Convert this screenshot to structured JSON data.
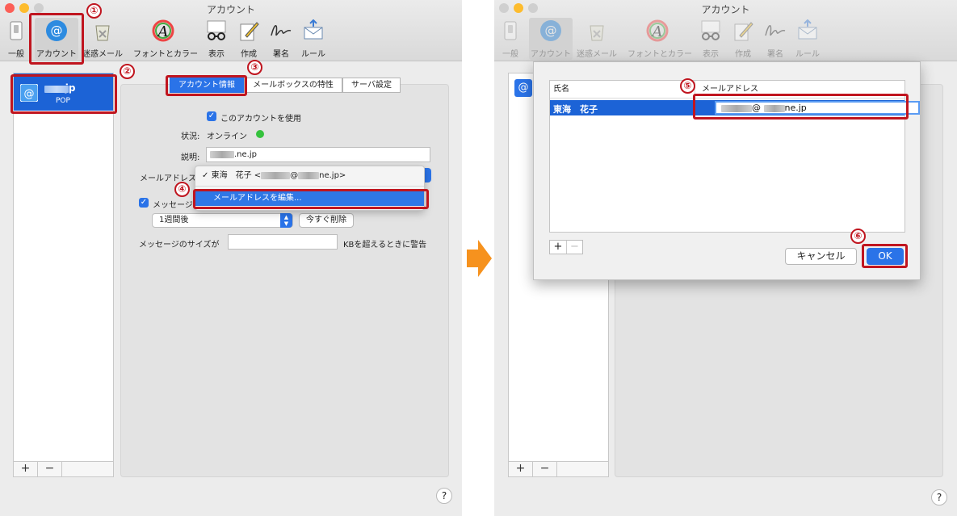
{
  "window_title": "アカウント",
  "toolbar": [
    "一般",
    "アカウント",
    "迷惑メール",
    "フォントとカラー",
    "表示",
    "作成",
    "署名",
    "ルール"
  ],
  "account": {
    "name_suffix": ".ne.jp",
    "type": "POP"
  },
  "account_list_buttons": {
    "add": "+",
    "remove": "−"
  },
  "tabs": [
    "アカウント情報",
    "メールボックスの特性",
    "サーバ設定"
  ],
  "settings": {
    "enable_label": "このアカウントを使用",
    "status_label": "状況:",
    "status_value": "オンライン",
    "description_label": "説明:",
    "description_suffix": ".ne.jp",
    "email_label": "メールアドレス",
    "messages_label": "メッセージ",
    "period_value": "1週間後",
    "delete_now_label": "今すぐ削除",
    "size_label": "メッセージのサイズが",
    "size_suffix": "KBを超えるときに警告"
  },
  "email_menu": {
    "check": "✓",
    "current_name": "東海　花子 <",
    "current_at": "@",
    "current_domain": "ne.jp>",
    "edit_label": "メールアドレスを編集..."
  },
  "help_label": "?",
  "annotations": [
    "①",
    "②",
    "③",
    "④",
    "⑤",
    "⑥"
  ],
  "edit_sheet": {
    "col_name": "氏名",
    "col_email": "メールアドレス",
    "row_name": "東海　花子",
    "row_email_at": "@",
    "row_email_domain": "ne.jp",
    "add": "+",
    "remove": "−",
    "cancel": "キャンセル",
    "ok": "OK"
  },
  "colors": {
    "accent": "#1c63d6",
    "annotation": "#c0151f",
    "arrow": "#f6921e",
    "status_online": "#35c23d"
  }
}
